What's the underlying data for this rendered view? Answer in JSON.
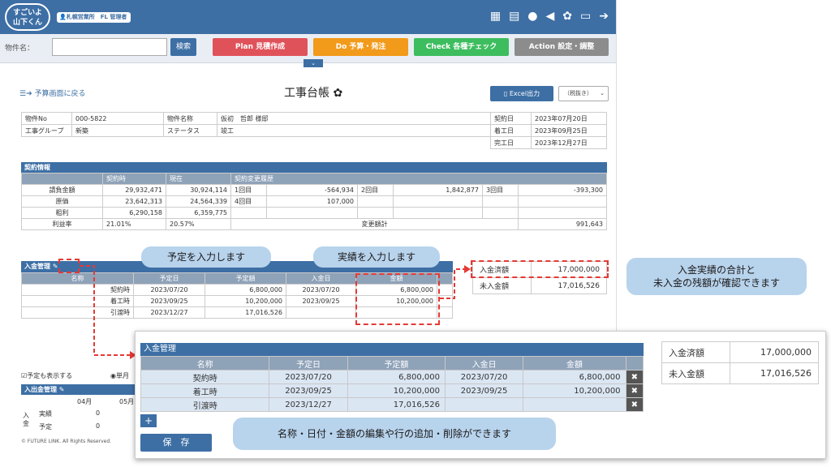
{
  "app": {
    "logo_line1": "すごいよ",
    "logo_line2": "山下くん",
    "user_badge": "札幌営業所　FL 管理者"
  },
  "topicons": [
    "building-icon",
    "calendar-icon",
    "chat-icon",
    "megaphone-icon",
    "gear-icon",
    "folder-icon",
    "logout-icon"
  ],
  "nav": {
    "label": "物件名：",
    "search_value": "",
    "search_btn": "検索",
    "tabs": [
      {
        "label": "Plan 見積作成",
        "color": "#e0525a"
      },
      {
        "label": "Do 予算・発注",
        "color": "#f29a1a"
      },
      {
        "label": "Check 各種チェック",
        "color": "#3dbd5e"
      },
      {
        "label": "Action 設定・調整",
        "color": "#8c8c8c"
      }
    ],
    "collapse": "⌄"
  },
  "page": {
    "back": "予算画面に戻る",
    "title": "工事台帳",
    "excel": "Excel出力",
    "tax_select": "（税抜き）"
  },
  "info": {
    "rows": [
      [
        "物件No",
        "000-5822",
        "物件名称",
        "仮初　哲郎 様邸",
        "契約日",
        "2023年07月20日"
      ],
      [
        "工事グループ",
        "新築",
        "ステータス",
        "竣工",
        "着工日",
        "2023年09月25日"
      ],
      [
        "",
        "",
        "",
        "",
        "完工日",
        "2023年12月27日"
      ]
    ]
  },
  "contract": {
    "title": "契約情報",
    "head": [
      "",
      "契約時",
      "現在",
      "契約変更履歴"
    ],
    "rows": [
      [
        "請負金額",
        "29,932,471",
        "30,924,114",
        "1回目",
        "-564,934",
        "2回目",
        "1,842,877",
        "3回目",
        "-393,300"
      ],
      [
        "原価",
        "23,642,313",
        "24,564,339",
        "4回目",
        "107,000",
        "",
        "",
        "",
        ""
      ],
      [
        "粗利",
        "6,290,158",
        "6,359,775",
        "",
        "",
        "",
        "",
        "",
        ""
      ],
      [
        "利益率",
        "21.01%",
        "20.57%",
        "",
        "",
        "変更額計",
        "",
        "",
        "991,643"
      ]
    ]
  },
  "payment": {
    "title": "入金管理",
    "head": [
      "名称",
      "予定日",
      "予定額",
      "入金日",
      "金額"
    ],
    "rows": [
      [
        "契約時",
        "2023/07/20",
        "6,800,000",
        "2023/07/20",
        "6,800,000"
      ],
      [
        "着工時",
        "2023/09/25",
        "10,200,000",
        "2023/09/25",
        "10,200,000"
      ],
      [
        "引渡時",
        "2023/12/27",
        "17,016,526",
        "",
        ""
      ]
    ]
  },
  "summary": {
    "paid_label": "入金済額",
    "paid": "17,000,000",
    "unpaid_label": "未入金額",
    "unpaid": "17,016,526"
  },
  "callouts": {
    "plan": "予定を入力します",
    "actual": "実績を入力します",
    "summary_l1": "入金実績の合計と",
    "summary_l2": "未入金の残額が確認できます",
    "edit": "名称・日付・金額の編集や行の追加・削除ができます"
  },
  "lower": {
    "check": "予定も表示する",
    "radio": "単月",
    "cash_title": "入出金管理",
    "month1": "04月",
    "month2": "05月",
    "side": "入金",
    "r1": "実績",
    "r2": "予定",
    "v1": "0",
    "v2": "0",
    "footer": "© FUTURE LINK. All Rights Reserved."
  },
  "zoom": {
    "add": "+",
    "save": "保　存",
    "del": "✖"
  }
}
